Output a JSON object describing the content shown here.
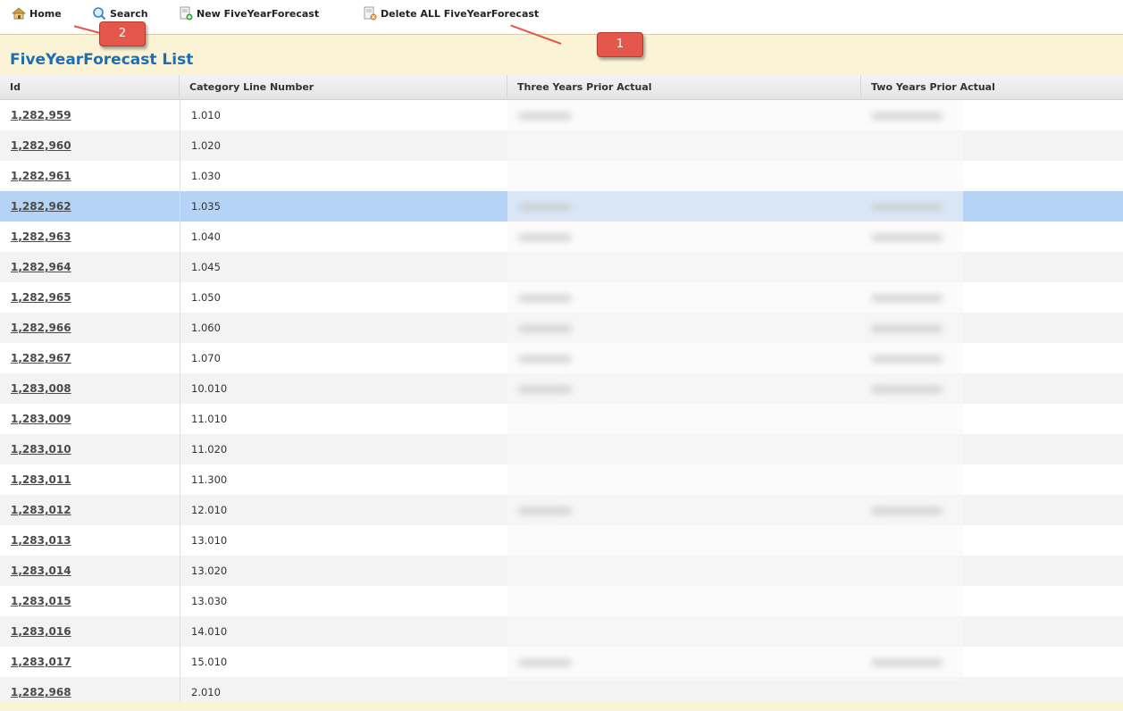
{
  "toolbar": {
    "home_label": "Home",
    "search_label": "Search",
    "new_label": "New FiveYearForecast",
    "delete_label": "Delete ALL FiveYearForecast"
  },
  "page": {
    "title": "FiveYearForecast List"
  },
  "table": {
    "columns": [
      "Id",
      "Category Line Number",
      "Three Years Prior Actual",
      "Two Years Prior Actual"
    ],
    "rows": [
      {
        "id": "1,282,959",
        "cat": "1.010"
      },
      {
        "id": "1,282,960",
        "cat": "1.020"
      },
      {
        "id": "1,282,961",
        "cat": "1.030"
      },
      {
        "id": "1,282,962",
        "cat": "1.035"
      },
      {
        "id": "1,282,963",
        "cat": "1.040"
      },
      {
        "id": "1,282,964",
        "cat": "1.045"
      },
      {
        "id": "1,282,965",
        "cat": "1.050"
      },
      {
        "id": "1,282,966",
        "cat": "1.060"
      },
      {
        "id": "1,282,967",
        "cat": "1.070"
      },
      {
        "id": "1,283,008",
        "cat": "10.010"
      },
      {
        "id": "1,283,009",
        "cat": "11.010"
      },
      {
        "id": "1,283,010",
        "cat": "11.020"
      },
      {
        "id": "1,283,011",
        "cat": "11.300"
      },
      {
        "id": "1,283,012",
        "cat": "12.010"
      },
      {
        "id": "1,283,013",
        "cat": "13.010"
      },
      {
        "id": "1,283,014",
        "cat": "13.020"
      },
      {
        "id": "1,283,015",
        "cat": "13.030"
      },
      {
        "id": "1,283,016",
        "cat": "14.010"
      },
      {
        "id": "1,283,017",
        "cat": "15.010"
      },
      {
        "id": "1,282,968",
        "cat": "2.010"
      }
    ],
    "selected_row_index": 3
  },
  "callouts": {
    "one": "1",
    "two": "2"
  },
  "colors": {
    "accent": "#1d6fb3",
    "callout": "#e4584c",
    "selected": "#b5d3f5",
    "title_bg": "#fbf3d5"
  }
}
